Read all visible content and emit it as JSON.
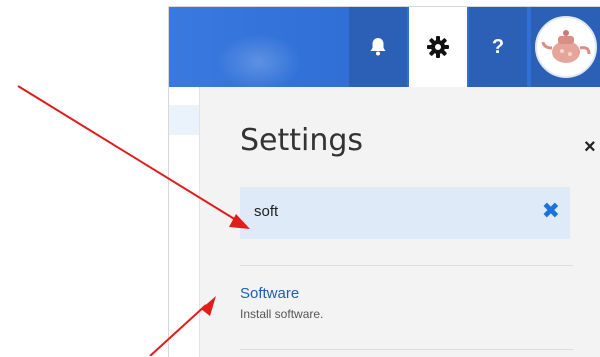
{
  "topbar": {
    "help_label": "?"
  },
  "settings_panel": {
    "title": "Settings",
    "close_label": "×",
    "search": {
      "value": "soft",
      "clear_label": "✖"
    },
    "results": [
      {
        "title": "Software",
        "description": "Install software."
      }
    ]
  },
  "colors": {
    "topbar_blue": "#2f6fd6",
    "link_blue": "#1e5fb1",
    "annotation_red": "#e21b1b"
  },
  "icons": {
    "bell": "bell-icon",
    "gear": "gear-icon",
    "help": "question-icon",
    "avatar": "teapot-avatar",
    "close": "close-icon",
    "clear": "clear-search-icon"
  }
}
